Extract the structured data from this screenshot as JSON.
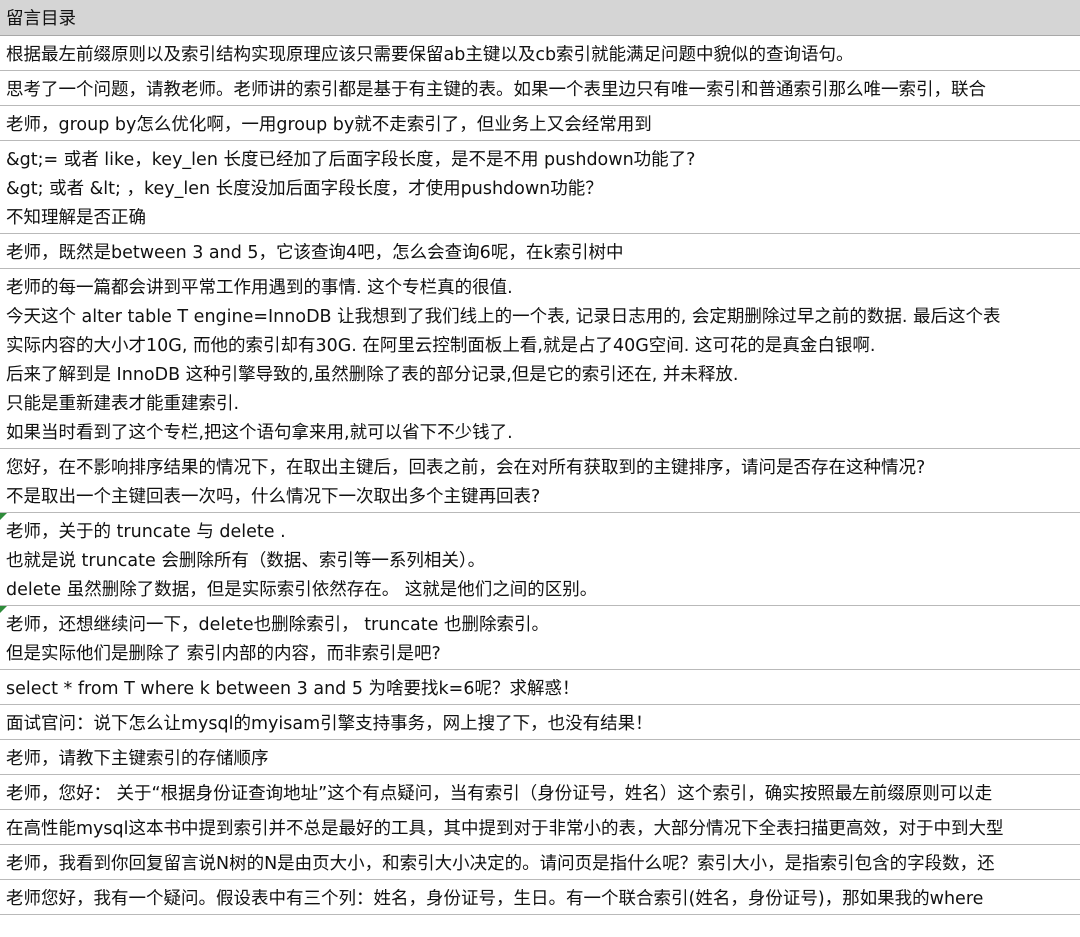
{
  "header": {
    "title": "留言目录"
  },
  "rows": [
    {
      "lines": [
        "根据最左前缀原则以及索引结构实现原理应该只需要保留ab主键以及cb索引就能满足问题中貌似的查询语句。"
      ]
    },
    {
      "lines": [
        "思考了一个问题，请教老师。老师讲的索引都是基于有主键的表。如果一个表里边只有唯一索引和普通索引那么唯一索引，联合"
      ]
    },
    {
      "lines": [
        "老师，group  by怎么优化啊，一用group by就不走索引了，但业务上又会经常用到"
      ]
    },
    {
      "lines": [
        "&gt;=  或者 like，key_len 长度已经加了后面字段长度，是不是不用 pushdown功能了?",
        "&gt;  或者 &lt;  ，key_len 长度没加后面字段长度，才使用pushdown功能？",
        "不知理解是否正确"
      ]
    },
    {
      "lines": [
        "老师，既然是between  3  and  5，它该查询4吧，怎么会查询6呢，在k索引树中"
      ]
    },
    {
      "lines": [
        "老师的每一篇都会讲到平常工作用遇到的事情. 这个专栏真的很值.",
        "今天这个 alter table T engine=InnoDB 让我想到了我们线上的一个表, 记录日志用的, 会定期删除过早之前的数据. 最后这个表",
        "实际内容的大小才10G, 而他的索引却有30G. 在阿里云控制面板上看,就是占了40G空间. 这可花的是真金白银啊.",
        "后来了解到是 InnoDB 这种引擎导致的,虽然删除了表的部分记录,但是它的索引还在, 并未释放.",
        "只能是重新建表才能重建索引.",
        "如果当时看到了这个专栏,把这个语句拿来用,就可以省下不少钱了."
      ]
    },
    {
      "lines": [
        "您好，在不影响排序结果的情况下，在取出主键后，回表之前，会在对所有获取到的主键排序，请问是否存在这种情况?",
        "不是取出一个主键回表一次吗，什么情况下一次取出多个主键再回表?"
      ]
    },
    {
      "lines": [
        "老师，关于的 truncate  与 delete  .",
        "也就是说 truncate  会删除所有（数据、索引等一系列相关）。",
        "delete  虽然删除了数据，但是实际索引依然存在。 这就是他们之间的区别。"
      ],
      "marker": true
    },
    {
      "lines": [
        "老师，还想继续问一下，delete也删除索引，  truncate 也删除索引。",
        "但是实际他们是删除了 索引内部的内容，而非索引是吧?"
      ],
      "marker": true
    },
    {
      "lines": [
        "select * from T where k between 3 and 5 为啥要找k=6呢？求解惑！"
      ]
    },
    {
      "lines": [
        "面试官问：说下怎么让mysql的myisam引擎支持事务，网上搜了下，也没有结果！"
      ]
    },
    {
      "lines": [
        "老师，请教下主键索引的存储顺序"
      ]
    },
    {
      "lines": [
        "老师，您好：  关于“根据身份证查询地址”这个有点疑问，当有索引（身份证号，姓名）这个索引，确实按照最左前缀原则可以走"
      ]
    },
    {
      "lines": [
        "在高性能mysql这本书中提到索引并不总是最好的工具，其中提到对于非常小的表，大部分情况下全表扫描更高效，对于中到大型"
      ]
    },
    {
      "lines": [
        "老师，我看到你回复留言说N树的N是由页大小，和索引大小决定的。请问页是指什么呢？索引大小，是指索引包含的字段数，还"
      ]
    },
    {
      "lines": [
        "老师您好，我有一个疑问。假设表中有三个列：姓名，身份证号，生日。有一个联合索引(姓名，身份证号)，那如果我的where"
      ]
    }
  ]
}
